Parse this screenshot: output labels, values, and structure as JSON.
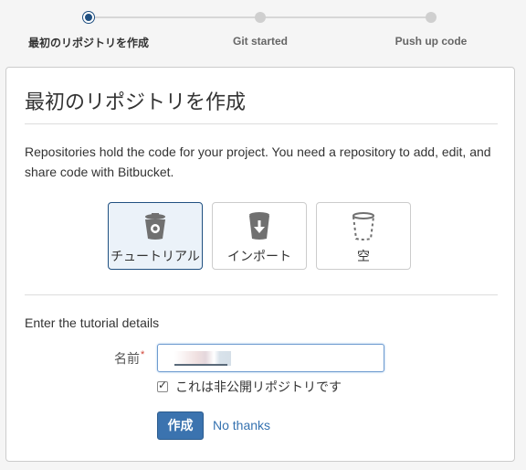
{
  "stepper": {
    "steps": [
      {
        "label": "最初のリポジトリを作成",
        "active": true
      },
      {
        "label": "Git started",
        "active": false
      },
      {
        "label": "Push up code",
        "active": false
      }
    ]
  },
  "card": {
    "title": "最初のリポジトリを作成",
    "description": "Repositories hold the code for your project. You need a repository to add, edit, and share code with Bitbucket.",
    "options": [
      {
        "label": "チュートリアル",
        "icon": "tutorial-bucket-icon",
        "selected": true
      },
      {
        "label": "インポート",
        "icon": "import-bucket-icon",
        "selected": false
      },
      {
        "label": "空",
        "icon": "empty-bucket-icon",
        "selected": false
      }
    ],
    "section_label": "Enter the tutorial details",
    "name_field": {
      "label": "名前",
      "required_mark": "*",
      "value": ""
    },
    "private_checkbox": {
      "label": "これは非公開リポジトリです",
      "checked": true
    },
    "create_button": "作成",
    "no_thanks_link": "No thanks"
  },
  "colors": {
    "accent": "#205081",
    "button": "#3b73af",
    "link": "#3572b0"
  }
}
